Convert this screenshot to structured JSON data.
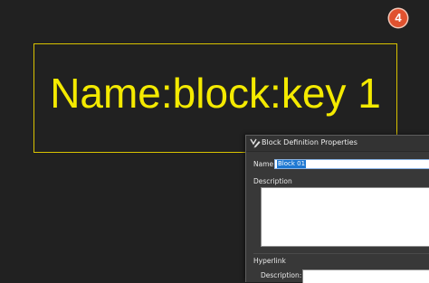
{
  "drawing": {
    "block_text": "Name:block:key 1",
    "frame_color": "#d9c300",
    "text_color": "#f4ea00"
  },
  "step_badge": {
    "label": "4",
    "color": "#e0522f"
  },
  "dialog": {
    "title": "Block Definition Properties",
    "title_icon": "block-edit-icon",
    "name_label": "Name:",
    "name_value": "Block 01",
    "description_label": "Description",
    "description_value": "",
    "hyperlink_group_label": "Hyperlink",
    "hyperlink_description_label": "Description:",
    "hyperlink_description_value": ""
  }
}
